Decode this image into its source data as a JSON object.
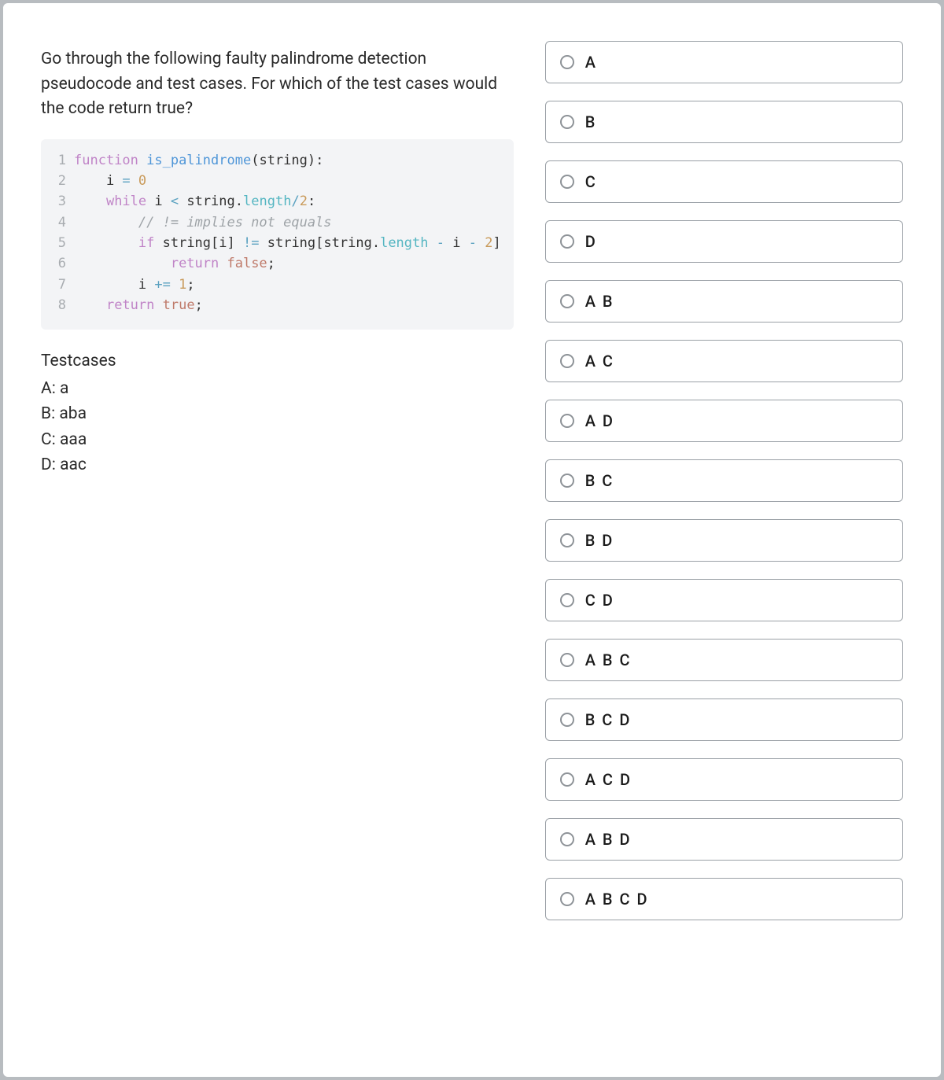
{
  "question": {
    "prompt": "Go through the following faulty palindrome detection pseudocode and test cases. For which of the test cases would the code return true?"
  },
  "code": {
    "lines": [
      {
        "n": "1",
        "tokens": [
          {
            "t": "function ",
            "c": "kw"
          },
          {
            "t": "is_palindrome",
            "c": "fn"
          },
          {
            "t": "(",
            "c": "param"
          },
          {
            "t": "string",
            "c": "param"
          },
          {
            "t": "):",
            "c": "param"
          }
        ]
      },
      {
        "n": "2",
        "tokens": [
          {
            "t": "    i ",
            "c": "var"
          },
          {
            "t": "= ",
            "c": "op"
          },
          {
            "t": "0",
            "c": "num"
          }
        ]
      },
      {
        "n": "3",
        "tokens": [
          {
            "t": "    ",
            "c": "var"
          },
          {
            "t": "while ",
            "c": "kw"
          },
          {
            "t": "i ",
            "c": "var"
          },
          {
            "t": "< ",
            "c": "op"
          },
          {
            "t": "string",
            "c": "var"
          },
          {
            "t": ".",
            "c": "var"
          },
          {
            "t": "length",
            "c": "prop"
          },
          {
            "t": "/",
            "c": "op"
          },
          {
            "t": "2",
            "c": "num"
          },
          {
            "t": ":",
            "c": "var"
          }
        ]
      },
      {
        "n": "4",
        "tokens": [
          {
            "t": "        ",
            "c": "var"
          },
          {
            "t": "// != implies not equals",
            "c": "cmnt"
          }
        ]
      },
      {
        "n": "5",
        "tokens": [
          {
            "t": "        ",
            "c": "var"
          },
          {
            "t": "if ",
            "c": "kw"
          },
          {
            "t": "string",
            "c": "var"
          },
          {
            "t": "[",
            "c": "var"
          },
          {
            "t": "i",
            "c": "var"
          },
          {
            "t": "] ",
            "c": "var"
          },
          {
            "t": "!= ",
            "c": "op"
          },
          {
            "t": "string",
            "c": "var"
          },
          {
            "t": "[",
            "c": "var"
          },
          {
            "t": "string",
            "c": "var"
          },
          {
            "t": ".",
            "c": "var"
          },
          {
            "t": "length",
            "c": "prop"
          },
          {
            "t": " - ",
            "c": "op"
          },
          {
            "t": "i",
            "c": "var"
          },
          {
            "t": " - ",
            "c": "op"
          },
          {
            "t": "2",
            "c": "num"
          },
          {
            "t": "]",
            "c": "var"
          }
        ]
      },
      {
        "n": "6",
        "tokens": [
          {
            "t": "            ",
            "c": "var"
          },
          {
            "t": "return ",
            "c": "kw"
          },
          {
            "t": "false",
            "c": "bool"
          },
          {
            "t": ";",
            "c": "var"
          }
        ]
      },
      {
        "n": "7",
        "tokens": [
          {
            "t": "        i ",
            "c": "var"
          },
          {
            "t": "+= ",
            "c": "op"
          },
          {
            "t": "1",
            "c": "num"
          },
          {
            "t": ";",
            "c": "var"
          }
        ]
      },
      {
        "n": "8",
        "tokens": [
          {
            "t": "    ",
            "c": "var"
          },
          {
            "t": "return ",
            "c": "kw"
          },
          {
            "t": "true",
            "c": "bool"
          },
          {
            "t": ";",
            "c": "var"
          }
        ]
      }
    ]
  },
  "testcases": {
    "title": "Testcases",
    "items": [
      {
        "label": "A:",
        "value": "a"
      },
      {
        "label": "B:",
        "value": "aba"
      },
      {
        "label": "C:",
        "value": "aaa"
      },
      {
        "label": "D:",
        "value": "aac"
      }
    ]
  },
  "options": [
    {
      "label": "A"
    },
    {
      "label": "B"
    },
    {
      "label": "C"
    },
    {
      "label": "D"
    },
    {
      "label": "A B"
    },
    {
      "label": "A C"
    },
    {
      "label": "A D"
    },
    {
      "label": "B C"
    },
    {
      "label": "B D"
    },
    {
      "label": "C D"
    },
    {
      "label": "A B C"
    },
    {
      "label": "B C D"
    },
    {
      "label": "A C D"
    },
    {
      "label": "A B D"
    },
    {
      "label": "A B C D"
    }
  ]
}
